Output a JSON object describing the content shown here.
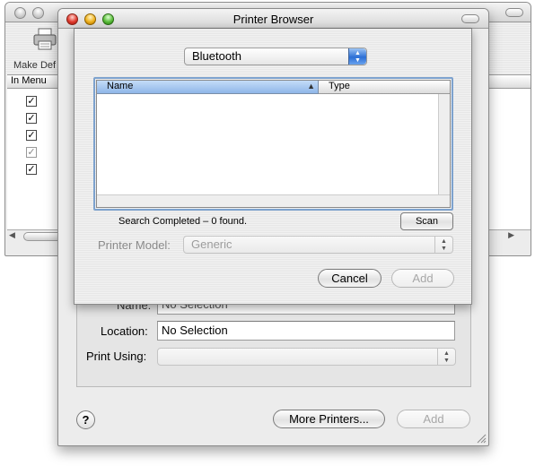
{
  "background_window": {
    "toolbar_label": "Make Def",
    "toolbar_label_cut": "De",
    "column_header": "In Menu",
    "checkbox_marks": [
      "✓",
      "✓",
      "✓",
      "✓",
      "✓"
    ]
  },
  "main_window": {
    "name_label": "Name:",
    "name_value": "No Selection",
    "location_label": "Location:",
    "location_value": "No Selection",
    "print_using_label": "Print Using:",
    "help_label": "?",
    "more_printers_label": "More Printers...",
    "add_label": "Add"
  },
  "browser_sheet": {
    "title": "Printer Browser",
    "connection_type": "Bluetooth",
    "columns": {
      "name": "Name",
      "type": "Type"
    },
    "status_text": "Search Completed – 0 found.",
    "scan_label": "Scan",
    "printer_model_label": "Printer Model:",
    "printer_model_value": "Generic",
    "cancel_label": "Cancel",
    "add_label": "Add"
  },
  "colors": {
    "focus_ring": "#7da2ce",
    "header_selected": "#8fb6e8"
  },
  "icons": [
    "printer-icon",
    "close-icon",
    "minimize-icon",
    "zoom-icon",
    "toolbar-toggle-icon",
    "sort-triangle-icon",
    "popup-arrows-icon",
    "resize-grip-icon"
  ]
}
